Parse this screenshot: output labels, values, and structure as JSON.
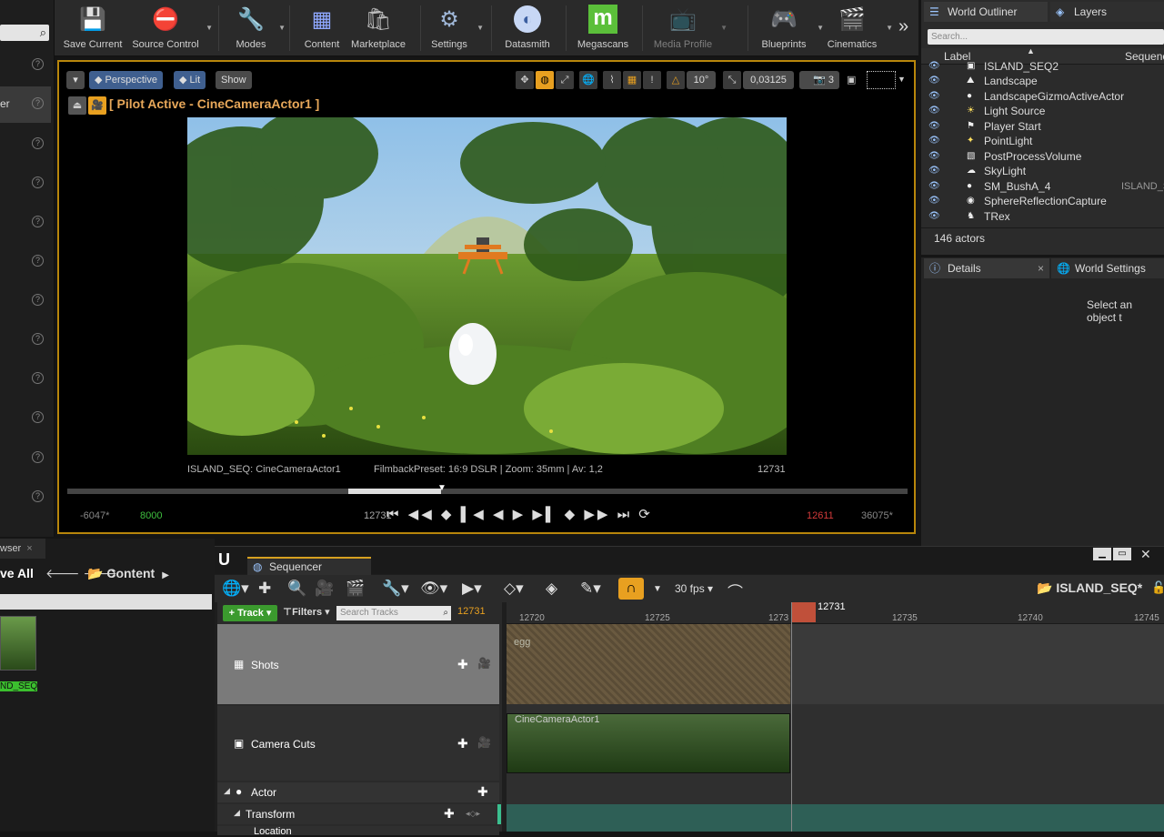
{
  "left_panel": {
    "rows": [
      {
        "label": ""
      },
      {
        "label": "er"
      },
      {
        "label": ""
      },
      {
        "label": ""
      },
      {
        "label": ""
      },
      {
        "label": ""
      },
      {
        "label": ""
      },
      {
        "label": ""
      },
      {
        "label": ""
      },
      {
        "label": ""
      },
      {
        "label": ""
      },
      {
        "label": ""
      }
    ]
  },
  "toolbar": {
    "items": [
      {
        "label": "Save Current",
        "icon": "save-icon",
        "glyph": "💾"
      },
      {
        "label": "Source Control",
        "icon": "source-control-icon",
        "glyph": "⛔"
      },
      {
        "label": "Modes",
        "icon": "modes-icon",
        "glyph": "🔧"
      },
      {
        "label": "Content",
        "icon": "content-icon",
        "glyph": "▦"
      },
      {
        "label": "Marketplace",
        "icon": "marketplace-icon",
        "glyph": "🛍"
      },
      {
        "label": "Settings",
        "icon": "settings-icon",
        "glyph": "⚙"
      },
      {
        "label": "Datasmith",
        "icon": "datasmith-icon",
        "glyph": "◐"
      },
      {
        "label": "Megascans",
        "icon": "megascans-icon",
        "glyph": "m"
      },
      {
        "label": "Media Profile",
        "icon": "media-profile-icon",
        "glyph": "📺"
      },
      {
        "label": "Blueprints",
        "icon": "blueprints-icon",
        "glyph": "🎮"
      },
      {
        "label": "Cinematics",
        "icon": "cinematics-icon",
        "glyph": "🎬"
      }
    ],
    "overflow": "»"
  },
  "viewport": {
    "perspective": "Perspective",
    "lit": "Lit",
    "show": "Show",
    "angle_snap": "10°",
    "scale_snap": "0,03125",
    "camera_speed": "3",
    "pilot_label": "[ Pilot Active - CineCameraActor1 ]",
    "info_left": "ISLAND_SEQ: CineCameraActor1",
    "info_mid": "FilmbackPreset: 16:9 DSLR | Zoom: 35mm | Av: 1,2",
    "info_right": "12731",
    "range_start": "-6047*",
    "play_start": "8000",
    "current": "12731",
    "play_end": "12611",
    "range_end": "36075*",
    "transport": "⏮ ◀◀ ◆ ▌◀ ◀ ▶ ▶▌ ◆ ▶▶ ⏭ ⟳"
  },
  "outliner": {
    "tab1": "World Outliner",
    "tab2": "Layers",
    "search_placeholder": "Search...",
    "col_label": "Label",
    "col_seq": "Sequenc",
    "rows": [
      {
        "name": "ISLAND_SEQ2",
        "extra": "",
        "glyph": "▣"
      },
      {
        "name": "Landscape",
        "extra": "",
        "glyph": "⛰"
      },
      {
        "name": "LandscapeGizmoActiveActor",
        "extra": "",
        "glyph": "●"
      },
      {
        "name": "Light Source",
        "extra": "",
        "glyph": "☀"
      },
      {
        "name": "Player Start",
        "extra": "",
        "glyph": "⚑"
      },
      {
        "name": "PointLight",
        "extra": "",
        "glyph": "💡"
      },
      {
        "name": "PostProcessVolume",
        "extra": "",
        "glyph": "▧"
      },
      {
        "name": "SkyLight",
        "extra": "",
        "glyph": "☁"
      },
      {
        "name": "SM_BushA_4",
        "extra": "ISLAND_S",
        "glyph": "●"
      },
      {
        "name": "SphereReflectionCapture",
        "extra": "",
        "glyph": "◉"
      },
      {
        "name": "TRex",
        "extra": "",
        "glyph": "♞"
      }
    ],
    "count": "146 actors"
  },
  "details": {
    "tab1": "Details",
    "tab2": "World Settings",
    "empty_msg": "Select an object t"
  },
  "content_browser": {
    "tab": "wser",
    "save_all": "ve All",
    "path": "Content",
    "asset_label": "ND_SEQ"
  },
  "sequencer": {
    "tab": "Sequencer",
    "fps": "30 fps",
    "seq_name": "ISLAND_SEQ*",
    "track_btn": "+ Track",
    "filters": "Filters",
    "search_placeholder": "Search Tracks",
    "current_frame": "12731",
    "playhead_label": "12731",
    "ruler": [
      "12720",
      "12725",
      "1273",
      "12735",
      "12740",
      "12745"
    ],
    "tracks": {
      "shots": "Shots",
      "camera_cuts": "Camera Cuts",
      "actor": "Actor",
      "transform": "Transform",
      "location": "Location"
    },
    "shot_section": "egg",
    "cut_section": "CineCameraActor1"
  },
  "colors": {
    "accent": "#d6a020",
    "active_green": "#3b9a2e",
    "snap_orange": "#e8a020",
    "playhead": "#c0503a"
  }
}
